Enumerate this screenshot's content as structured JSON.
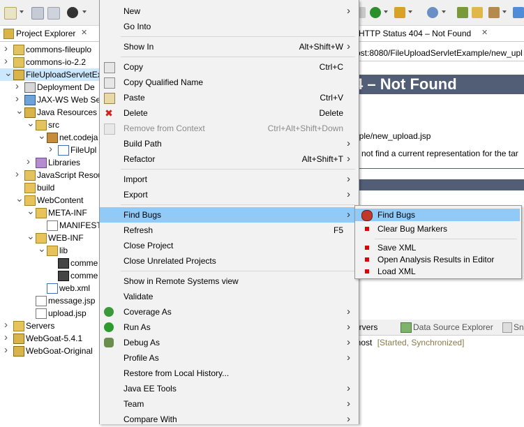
{
  "explorer": {
    "tab_label": "Project Explorer",
    "tree": [
      {
        "label": "commons-fileuplo",
        "depth": 0,
        "twisty": ">",
        "icon": "jar-folder"
      },
      {
        "label": "commons-io-2.2",
        "depth": 0,
        "twisty": ">",
        "icon": "jar-folder"
      },
      {
        "label": "FileUploadServletEx",
        "depth": 0,
        "twisty": "v",
        "icon": "project",
        "selected": true
      },
      {
        "label": "Deployment De",
        "depth": 1,
        "twisty": ">",
        "icon": "descriptor"
      },
      {
        "label": "JAX-WS Web Se",
        "depth": 1,
        "twisty": ">",
        "icon": "webservice"
      },
      {
        "label": "Java Resources",
        "depth": 1,
        "twisty": "v",
        "icon": "java-resources"
      },
      {
        "label": "src",
        "depth": 2,
        "twisty": "v",
        "icon": "src-folder"
      },
      {
        "label": "net.codeja",
        "depth": 3,
        "twisty": "v",
        "icon": "package"
      },
      {
        "label": "FileUpl",
        "depth": 4,
        "twisty": ">",
        "icon": "java-file"
      },
      {
        "label": "Libraries",
        "depth": 2,
        "twisty": ">",
        "icon": "library"
      },
      {
        "label": "JavaScript Resou",
        "depth": 1,
        "twisty": ">",
        "icon": "js-resources"
      },
      {
        "label": "build",
        "depth": 1,
        "twisty": "",
        "icon": "folder"
      },
      {
        "label": "WebContent",
        "depth": 1,
        "twisty": "v",
        "icon": "folder"
      },
      {
        "label": "META-INF",
        "depth": 2,
        "twisty": "v",
        "icon": "folder"
      },
      {
        "label": "MANIFEST",
        "depth": 3,
        "twisty": "",
        "icon": "file"
      },
      {
        "label": "WEB-INF",
        "depth": 2,
        "twisty": "v",
        "icon": "folder"
      },
      {
        "label": "lib",
        "depth": 3,
        "twisty": "v",
        "icon": "folder"
      },
      {
        "label": "comme",
        "depth": 4,
        "twisty": "",
        "icon": "jar"
      },
      {
        "label": "comme",
        "depth": 4,
        "twisty": "",
        "icon": "jar"
      },
      {
        "label": "web.xml",
        "depth": 3,
        "twisty": "",
        "icon": "xml-file"
      },
      {
        "label": "message.jsp",
        "depth": 2,
        "twisty": "",
        "icon": "jsp-file"
      },
      {
        "label": "upload.jsp",
        "depth": 2,
        "twisty": "",
        "icon": "jsp-file"
      },
      {
        "label": "Servers",
        "depth": 0,
        "twisty": ">",
        "icon": "folder"
      },
      {
        "label": "WebGoat-5.4.1",
        "depth": 0,
        "twisty": ">",
        "icon": "project"
      },
      {
        "label": "WebGoat-Original",
        "depth": 0,
        "twisty": ">",
        "icon": "project"
      }
    ]
  },
  "editor": {
    "tab_label": "HTTP Status 404 – Not Found",
    "url_text": "ost:8080/FileUploadServletExample/new_upl",
    "heading": "4 – Not Found",
    "line1": "nple/new_upload.jsp",
    "line2": "d not find a current representation for the tar"
  },
  "bottom_panel": {
    "tab_servers": "ervers",
    "tab_datasource": "Data Source Explorer",
    "tab_snippets": "Sni",
    "server_row_text": "lhost",
    "server_status": "[Started, Synchronized]"
  },
  "context_menu": {
    "items": [
      {
        "label": "New",
        "accel": "",
        "submenu": true,
        "icon": ""
      },
      {
        "label": "Go Into",
        "accel": "",
        "submenu": false,
        "icon": ""
      },
      {
        "sep": true
      },
      {
        "label": "Show In",
        "accel": "Alt+Shift+W",
        "submenu": true,
        "icon": ""
      },
      {
        "sep": true
      },
      {
        "label": "Copy",
        "accel": "Ctrl+C",
        "submenu": false,
        "icon": "copy-icon"
      },
      {
        "label": "Copy Qualified Name",
        "accel": "",
        "submenu": false,
        "icon": "copy-icon"
      },
      {
        "label": "Paste",
        "accel": "Ctrl+V",
        "submenu": false,
        "icon": "paste-icon"
      },
      {
        "label": "Delete",
        "accel": "Delete",
        "submenu": false,
        "icon": "delete-icon"
      },
      {
        "label": "Remove from Context",
        "accel": "Ctrl+Alt+Shift+Down",
        "submenu": false,
        "icon": "remove-icon",
        "disabled": true
      },
      {
        "label": "Build Path",
        "accel": "",
        "submenu": true,
        "icon": ""
      },
      {
        "label": "Refactor",
        "accel": "Alt+Shift+T",
        "submenu": true,
        "icon": ""
      },
      {
        "sep": true
      },
      {
        "label": "Import",
        "accel": "",
        "submenu": true,
        "icon": ""
      },
      {
        "label": "Export",
        "accel": "",
        "submenu": true,
        "icon": ""
      },
      {
        "sep": true
      },
      {
        "label": "Find Bugs",
        "accel": "",
        "submenu": true,
        "icon": "",
        "highlighted": true
      },
      {
        "label": "Refresh",
        "accel": "F5",
        "submenu": false,
        "icon": ""
      },
      {
        "label": "Close Project",
        "accel": "",
        "submenu": false,
        "icon": ""
      },
      {
        "label": "Close Unrelated Projects",
        "accel": "",
        "submenu": false,
        "icon": ""
      },
      {
        "sep": true
      },
      {
        "label": "Show in Remote Systems view",
        "accel": "",
        "submenu": false,
        "icon": ""
      },
      {
        "label": "Validate",
        "accel": "",
        "submenu": false,
        "icon": ""
      },
      {
        "label": "Coverage As",
        "accel": "",
        "submenu": true,
        "icon": "coverage-icon"
      },
      {
        "label": "Run As",
        "accel": "",
        "submenu": true,
        "icon": "run-icon"
      },
      {
        "label": "Debug As",
        "accel": "",
        "submenu": true,
        "icon": "debug-icon"
      },
      {
        "label": "Profile As",
        "accel": "",
        "submenu": true,
        "icon": ""
      },
      {
        "label": "Restore from Local History...",
        "accel": "",
        "submenu": false,
        "icon": ""
      },
      {
        "label": "Java EE Tools",
        "accel": "",
        "submenu": true,
        "icon": ""
      },
      {
        "label": "Team",
        "accel": "",
        "submenu": true,
        "icon": ""
      },
      {
        "label": "Compare With",
        "accel": "",
        "submenu": true,
        "icon": ""
      }
    ]
  },
  "submenu": {
    "items": [
      {
        "label": "Find Bugs",
        "icon": "bug-icon",
        "highlighted": true
      },
      {
        "label": "Clear Bug Markers",
        "icon": "red-bullet"
      },
      {
        "sep": true
      },
      {
        "label": "Save XML",
        "icon": "red-bullet"
      },
      {
        "label": "Open Analysis Results in Editor",
        "icon": "red-bullet"
      },
      {
        "label": "Load XML",
        "icon": "red-bullet"
      }
    ]
  },
  "colors": {
    "menu_bg": "#f2f2f2",
    "highlight": "#91c9f7",
    "tomcat_band": "#525d76",
    "selection": "#cce8ff"
  }
}
